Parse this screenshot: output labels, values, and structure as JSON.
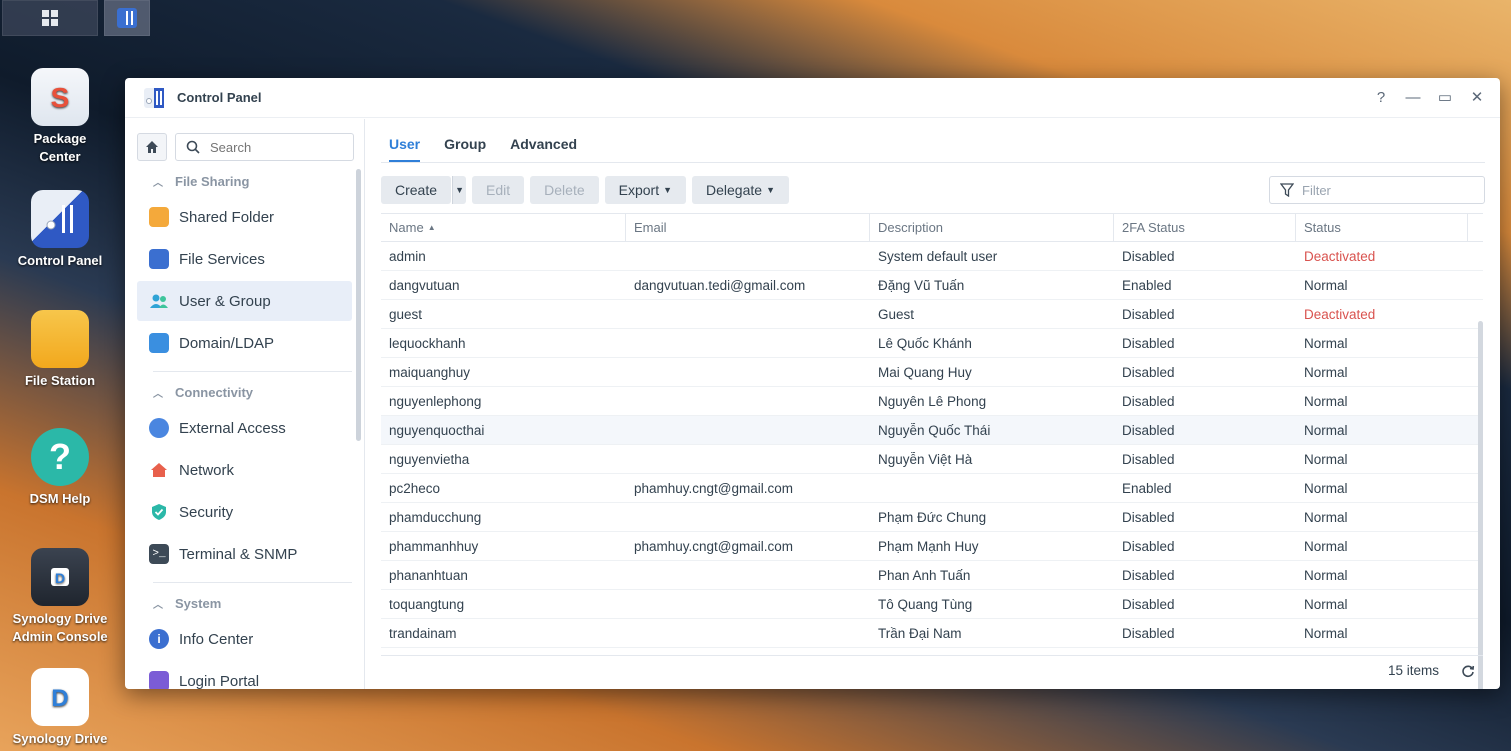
{
  "desktop": {
    "icons": [
      {
        "label": "Package\nCenter",
        "line1": "Package",
        "line2": "Center"
      },
      {
        "label": "Control Panel"
      },
      {
        "label": "File Station"
      },
      {
        "label": "DSM Help"
      },
      {
        "line1": "Synology Drive",
        "line2": "Admin Console"
      },
      {
        "label": "Synology Drive"
      }
    ]
  },
  "window": {
    "title": "Control Panel",
    "controls": {
      "help": "?",
      "minimize": "—",
      "maximize": "▭",
      "close": "✕"
    }
  },
  "sidebar": {
    "search_placeholder": "Search",
    "sections": [
      {
        "title": "File Sharing",
        "items": [
          "Shared Folder",
          "File Services",
          "User & Group",
          "Domain/LDAP"
        ]
      },
      {
        "title": "Connectivity",
        "items": [
          "External Access",
          "Network",
          "Security",
          "Terminal & SNMP"
        ]
      },
      {
        "title": "System",
        "items": [
          "Info Center",
          "Login Portal"
        ]
      }
    ]
  },
  "tabs": [
    "User",
    "Group",
    "Advanced"
  ],
  "toolbar": {
    "create": "Create",
    "edit": "Edit",
    "delete": "Delete",
    "export": "Export",
    "delegate": "Delegate",
    "filter_placeholder": "Filter"
  },
  "table": {
    "columns": [
      "Name",
      "Email",
      "Description",
      "2FA Status",
      "Status"
    ],
    "rows": [
      {
        "name": "admin",
        "email": "",
        "description": "System default user",
        "tfa": "Disabled",
        "status": "Deactivated"
      },
      {
        "name": "dangvutuan",
        "email": "dangvutuan.tedi@gmail.com",
        "description": "Đặng Vũ Tuấn",
        "tfa": "Enabled",
        "status": "Normal"
      },
      {
        "name": "guest",
        "email": "",
        "description": "Guest",
        "tfa": "Disabled",
        "status": "Deactivated"
      },
      {
        "name": "lequockhanh",
        "email": "",
        "description": "Lê Quốc Khánh",
        "tfa": "Disabled",
        "status": "Normal"
      },
      {
        "name": "maiquanghuy",
        "email": "",
        "description": "Mai Quang Huy",
        "tfa": "Disabled",
        "status": "Normal"
      },
      {
        "name": "nguyenlephong",
        "email": "",
        "description": "Nguyên Lê Phong",
        "tfa": "Disabled",
        "status": "Normal"
      },
      {
        "name": "nguyenquocthai",
        "email": "",
        "description": "Nguyễn Quốc Thái",
        "tfa": "Disabled",
        "status": "Normal"
      },
      {
        "name": "nguyenvietha",
        "email": "",
        "description": "Nguyễn Việt Hà",
        "tfa": "Disabled",
        "status": "Normal"
      },
      {
        "name": "pc2heco",
        "email": "phamhuy.cngt@gmail.com",
        "description": "",
        "tfa": "Enabled",
        "status": "Normal"
      },
      {
        "name": "phamducchung",
        "email": "",
        "description": "Phạm Đức Chung",
        "tfa": "Disabled",
        "status": "Normal"
      },
      {
        "name": "phammanhhuy",
        "email": "phamhuy.cngt@gmail.com",
        "description": "Phạm Mạnh Huy",
        "tfa": "Disabled",
        "status": "Normal"
      },
      {
        "name": "phananhtuan",
        "email": "",
        "description": "Phan Anh Tuấn",
        "tfa": "Disabled",
        "status": "Normal"
      },
      {
        "name": "toquangtung",
        "email": "",
        "description": "Tô Quang Tùng",
        "tfa": "Disabled",
        "status": "Normal"
      },
      {
        "name": "trandainam",
        "email": "",
        "description": "Trần Đại Nam",
        "tfa": "Disabled",
        "status": "Normal"
      }
    ],
    "item_count": "15 items"
  },
  "colors": {
    "accent": "#2f7fd8",
    "deactivated": "#d9534f"
  }
}
